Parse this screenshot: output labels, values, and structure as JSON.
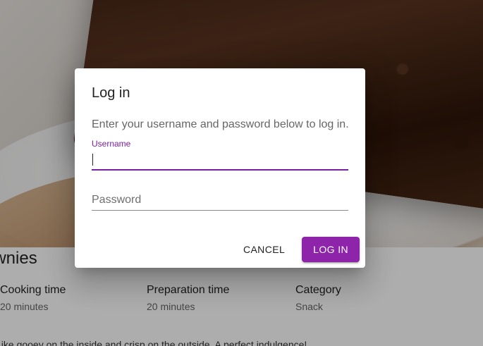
{
  "recipe": {
    "title": "ownies",
    "cooking_time_label": "Cooking time",
    "cooking_time_value": "20 minutes",
    "prep_time_label": "Preparation time",
    "prep_time_value": "20 minutes",
    "category_label": "Category",
    "category_value": "Snack",
    "description": "Like gooey on the inside and crisp on the outside. A perfect indulgence!"
  },
  "dialog": {
    "title": "Log in",
    "description": "Enter your username and password below to log in.",
    "username": {
      "label": "Username",
      "value": ""
    },
    "password": {
      "placeholder": "Password",
      "value": ""
    },
    "cancel_label": "CANCEL",
    "login_label": "LOG IN"
  },
  "colors": {
    "accent": "#8e24aa",
    "accent_label": "#7b1fa2"
  }
}
